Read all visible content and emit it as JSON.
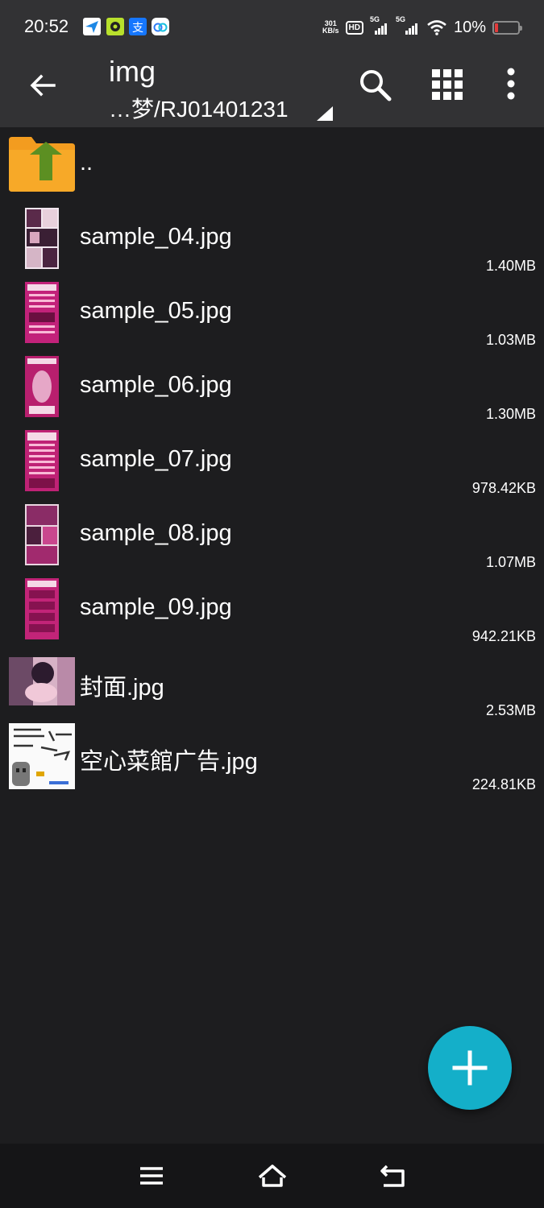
{
  "status_bar": {
    "time": "20:52",
    "net_speed_value": "301",
    "net_speed_unit": "KB/s",
    "hd_label": "HD",
    "sim1_label": "5G",
    "sim2_label": "5G",
    "battery_text": "10%",
    "notification_icons": [
      "feishu-icon",
      "game-app-icon",
      "alipay-icon",
      "baidu-netdisk-icon"
    ]
  },
  "toolbar": {
    "title": "img",
    "path": "…梦/RJ01401231"
  },
  "files": [
    {
      "name": "..",
      "size": "",
      "type": "parent-folder"
    },
    {
      "name": "sample_04.jpg",
      "size": "1.40MB",
      "type": "image"
    },
    {
      "name": "sample_05.jpg",
      "size": "1.03MB",
      "type": "image"
    },
    {
      "name": "sample_06.jpg",
      "size": "1.30MB",
      "type": "image"
    },
    {
      "name": "sample_07.jpg",
      "size": "978.42KB",
      "type": "image"
    },
    {
      "name": "sample_08.jpg",
      "size": "1.07MB",
      "type": "image"
    },
    {
      "name": "sample_09.jpg",
      "size": "942.21KB",
      "type": "image"
    },
    {
      "name": "封面.jpg",
      "size": "2.53MB",
      "type": "image"
    },
    {
      "name": "空心菜館广告.jpg",
      "size": "224.81KB",
      "type": "image"
    }
  ],
  "colors": {
    "background": "#1d1d1f",
    "toolbar": "#323234",
    "fab": "#14afc9",
    "folder": "#f39c1f",
    "folder_arrow": "#5c8f22"
  }
}
